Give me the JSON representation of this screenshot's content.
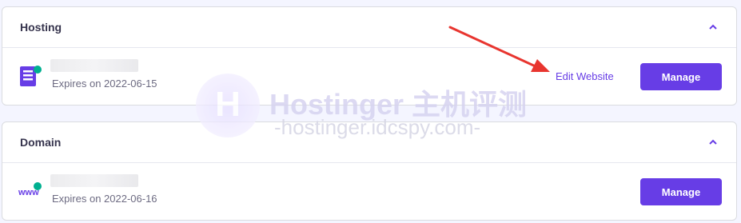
{
  "sections": [
    {
      "title": "Hosting",
      "icon": "hosting-server-icon",
      "expires": "Expires on 2022-06-15",
      "edit_label": "Edit Website",
      "manage_label": "Manage"
    },
    {
      "title": "Domain",
      "icon": "www-domain-icon",
      "expires": "Expires on 2022-06-16",
      "manage_label": "Manage",
      "icon_text": "www"
    }
  ],
  "watermark": {
    "logo_letter": "H",
    "title": "Hostinger 主机评测",
    "subtitle": "-hostinger.idcspy.com-"
  },
  "colors": {
    "accent": "#673de6",
    "status_dot": "#00b090",
    "annotation_arrow": "#e8352f"
  }
}
